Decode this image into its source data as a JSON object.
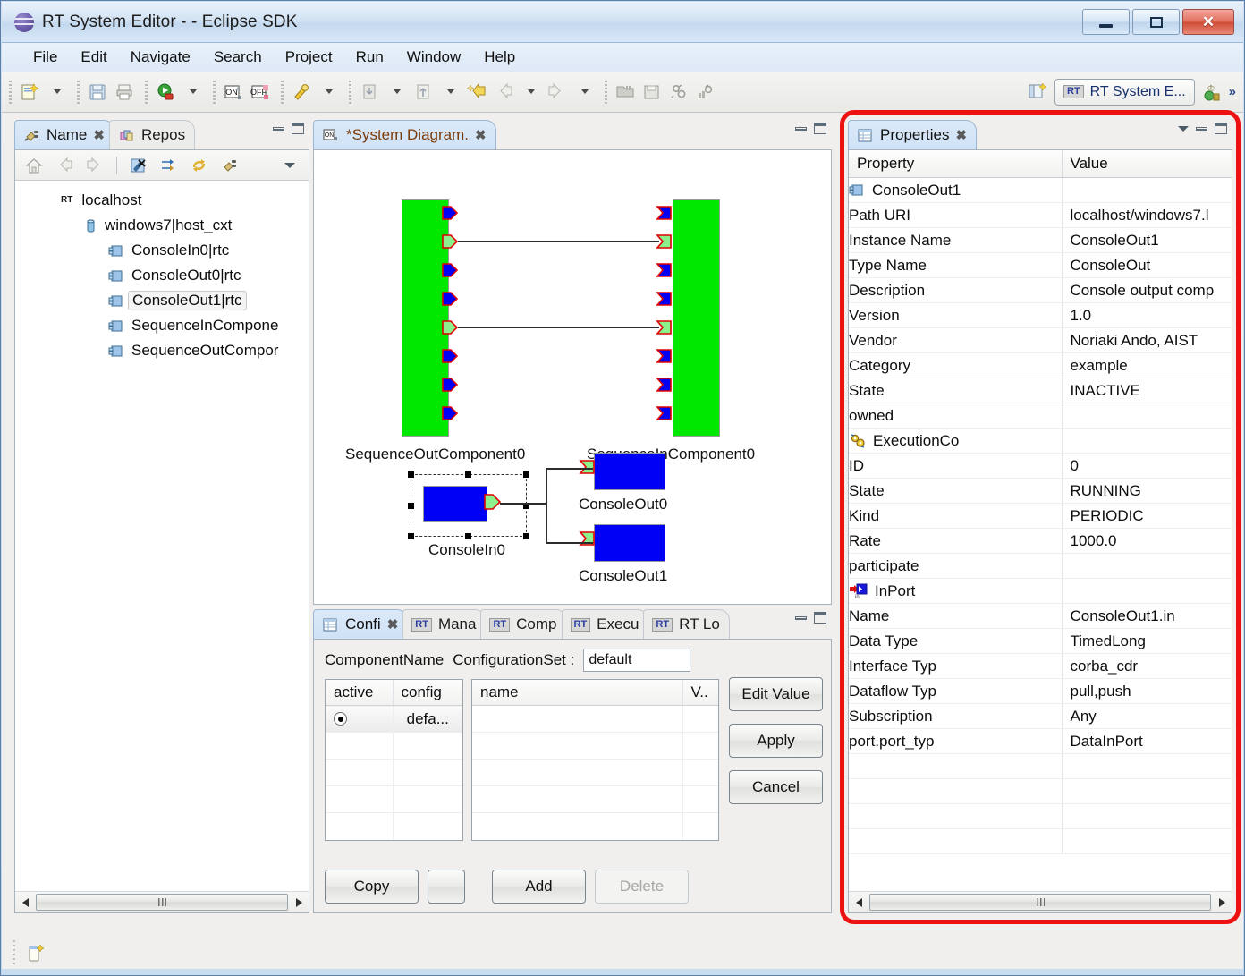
{
  "window": {
    "title": "RT System Editor -  - Eclipse SDK",
    "logo_icon": "eclipse-logo-icon",
    "minimize_label": "Minimize",
    "maximize_label": "Maximize",
    "close_label": "Close"
  },
  "menubar": {
    "items": [
      "File",
      "Edit",
      "Navigate",
      "Search",
      "Project",
      "Run",
      "Window",
      "Help"
    ]
  },
  "toolbar": {
    "groups": [
      [
        "new-wizard-icon",
        "dropdown-arrow"
      ],
      [
        "save-icon",
        "print-icon"
      ],
      [
        "run-icon",
        "dropdown-arrow"
      ],
      [
        "on-icon",
        "off-icon"
      ],
      [
        "debug-icon",
        "dropdown-arrow"
      ],
      [
        "import-icon",
        "dropdown-arrow",
        "export-icon",
        "dropdown-arrow",
        "quick-fix-icon",
        "back-icon",
        "dropdown-arrow",
        "forward-icon",
        "dropdown-arrow"
      ],
      [
        "open-system-icon",
        "save-system-icon",
        "offline-editor-icon",
        "online-editor-icon"
      ]
    ],
    "open_perspective_icon": "open-perspective-icon",
    "perspective_badge": "RT",
    "perspective_label": "RT System E...",
    "perspective_extra_icon": "rt-perspective-icon",
    "overflow_label": "»"
  },
  "name_view": {
    "tabs": [
      {
        "label": "Name",
        "icon": "plug-icon",
        "active": true,
        "closable": true
      },
      {
        "label": "Repos",
        "icon": "repository-icon",
        "active": false,
        "closable": false
      }
    ],
    "toolbar_icons": [
      "home-icon",
      "back-icon",
      "forward-icon",
      "separator",
      "delete-icon",
      "sync-icon",
      "refresh-icon",
      "connect-icon",
      "view-menu-icon"
    ],
    "tree": [
      {
        "label": "localhost",
        "icon": "rt-naming-icon",
        "indent": 0,
        "selected": false
      },
      {
        "label": "windows7|host_cxt",
        "icon": "context-icon",
        "indent": 1,
        "selected": false
      },
      {
        "label": "ConsoleIn0|rtc",
        "icon": "rtc-icon",
        "indent": 2,
        "selected": false
      },
      {
        "label": "ConsoleOut0|rtc",
        "icon": "rtc-icon",
        "indent": 2,
        "selected": false
      },
      {
        "label": "ConsoleOut1|rtc",
        "icon": "rtc-icon",
        "indent": 2,
        "selected": true
      },
      {
        "label": "SequenceInCompone",
        "icon": "rtc-icon",
        "indent": 2,
        "selected": false
      },
      {
        "label": "SequenceOutCompor",
        "icon": "rtc-icon",
        "indent": 2,
        "selected": false
      }
    ]
  },
  "editor": {
    "tab": {
      "label": "*System Diagram.",
      "icon": "system-diagram-icon",
      "dirty": true
    },
    "diagram": {
      "components": [
        {
          "name": "SequenceOutComponent0",
          "color": "#00e800",
          "kind": "green-rtc"
        },
        {
          "name": "SequenceInComponent0",
          "color": "#00e800",
          "kind": "green-rtc"
        },
        {
          "name": "ConsoleIn0",
          "color": "#0000f5",
          "kind": "blue-rtc",
          "selected": true
        },
        {
          "name": "ConsoleOut0",
          "color": "#0000f5",
          "kind": "blue-rtc"
        },
        {
          "name": "ConsoleOut1",
          "color": "#0000f5",
          "kind": "blue-rtc"
        }
      ],
      "connection_count": 4
    }
  },
  "properties_view": {
    "tab": {
      "label": "Properties",
      "icon": "properties-icon"
    },
    "columns": [
      "Property",
      "Value"
    ],
    "rows": [
      {
        "key": "ConsoleOut1",
        "value": "",
        "indent": 0,
        "icon": "rtc-icon"
      },
      {
        "key": "Path URI",
        "value": "localhost/windows7.l",
        "indent": 1,
        "icon": ""
      },
      {
        "key": "Instance Name",
        "value": "ConsoleOut1",
        "indent": 1,
        "icon": ""
      },
      {
        "key": "Type Name",
        "value": "ConsoleOut",
        "indent": 1,
        "icon": ""
      },
      {
        "key": "Description",
        "value": "Console output comp",
        "indent": 1,
        "icon": ""
      },
      {
        "key": "Version",
        "value": "1.0",
        "indent": 1,
        "icon": ""
      },
      {
        "key": "Vendor",
        "value": "Noriaki Ando, AIST",
        "indent": 1,
        "icon": ""
      },
      {
        "key": "Category",
        "value": "example",
        "indent": 1,
        "icon": ""
      },
      {
        "key": "State",
        "value": "INACTIVE",
        "indent": 1,
        "icon": ""
      },
      {
        "key": "owned",
        "value": "",
        "indent": 1,
        "icon": ""
      },
      {
        "key": "ExecutionCo",
        "value": "",
        "indent": 1,
        "icon": "execution-context-icon"
      },
      {
        "key": "ID",
        "value": "0",
        "indent": 2,
        "icon": ""
      },
      {
        "key": "State",
        "value": "RUNNING",
        "indent": 2,
        "icon": ""
      },
      {
        "key": "Kind",
        "value": "PERIODIC",
        "indent": 2,
        "icon": ""
      },
      {
        "key": "Rate",
        "value": "1000.0",
        "indent": 2,
        "icon": ""
      },
      {
        "key": "participate",
        "value": "",
        "indent": 1,
        "icon": ""
      },
      {
        "key": "InPort",
        "value": "",
        "indent": 0,
        "icon": "inport-icon"
      },
      {
        "key": "Name",
        "value": "ConsoleOut1.in",
        "indent": 2,
        "icon": ""
      },
      {
        "key": "Data Type",
        "value": "TimedLong",
        "indent": 2,
        "icon": ""
      },
      {
        "key": "Interface Typ",
        "value": "corba_cdr",
        "indent": 2,
        "icon": ""
      },
      {
        "key": "Dataflow Typ",
        "value": "pull,push",
        "indent": 2,
        "icon": ""
      },
      {
        "key": "Subscription",
        "value": "Any",
        "indent": 2,
        "icon": ""
      },
      {
        "key": "port.port_typ",
        "value": "DataInPort",
        "indent": 2,
        "icon": ""
      }
    ]
  },
  "config_view": {
    "tabs": [
      {
        "label": "Confi",
        "icon": "configuration-icon",
        "active": true,
        "closable": true
      },
      {
        "label": "Mana",
        "icon": "rt-icon",
        "active": false,
        "closable": false
      },
      {
        "label": "Comp",
        "icon": "rt-icon",
        "active": false,
        "closable": false
      },
      {
        "label": "Execu",
        "icon": "rt-icon",
        "active": false,
        "closable": false
      },
      {
        "label": "RT Lo",
        "icon": "rt-icon",
        "active": false,
        "closable": false
      }
    ],
    "component_name_label": "ComponentName",
    "configuration_set_label": "ConfigurationSet :",
    "configuration_set_value": "default",
    "left_table": {
      "columns": [
        "active",
        "config"
      ],
      "rows": [
        {
          "active": "radio-selected",
          "config": "defa..."
        }
      ],
      "empty_rows": 4
    },
    "right_table": {
      "columns": [
        "name",
        "V.."
      ],
      "empty_rows": 5
    },
    "buttons": {
      "edit_value": "Edit Value",
      "apply": "Apply",
      "cancel": "Cancel",
      "copy": "Copy",
      "blank": "",
      "add": "Add",
      "delete": "Delete"
    }
  },
  "statusbar": {
    "icon": "new-item-icon"
  },
  "annotation": {
    "color": "#ee1111",
    "shape": "rounded-rectangle",
    "target": "properties-view"
  }
}
